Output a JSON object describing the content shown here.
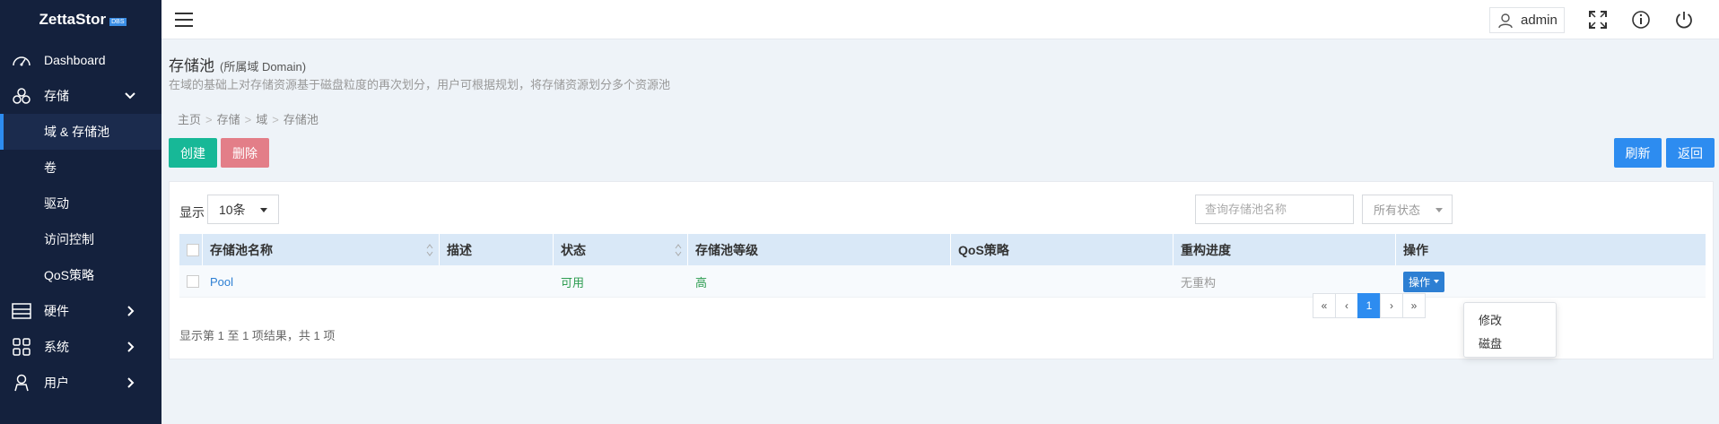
{
  "brand": {
    "name": "ZettaStor",
    "tag": "DBS"
  },
  "sidebar": {
    "items": [
      {
        "label": "Dashboard",
        "icon": "speedometer-icon"
      },
      {
        "label": "存储",
        "icon": "cubes-icon",
        "expanded": true
      },
      {
        "label": "硬件",
        "icon": "server-icon"
      },
      {
        "label": "系统",
        "icon": "grid-icon"
      },
      {
        "label": "用户",
        "icon": "user-icon"
      }
    ],
    "sub_items": [
      "域 & 存储池",
      "卷",
      "驱动",
      "访问控制",
      "QoS策略"
    ],
    "active_sub": "域 & 存储池"
  },
  "topbar": {
    "user": "admin",
    "icons": [
      "fullscreen-icon",
      "info-icon",
      "power-icon"
    ]
  },
  "page": {
    "title": "存储池",
    "subtitle": "(所属域 Domain)",
    "description": "在域的基础上对存储资源基于磁盘粒度的再次划分，用户可根据规划，将存储资源划分多个资源池",
    "breadcrumb": [
      "主页",
      "存储",
      "域",
      "存储池"
    ]
  },
  "actions": {
    "create": "创建",
    "delete": "删除",
    "refresh": "刷新",
    "back": "返回"
  },
  "table_controls": {
    "show_label": "显示",
    "page_size": "10条",
    "search_placeholder": "查询存储池名称",
    "status_filter": "所有状态"
  },
  "table": {
    "columns": [
      "存储池名称",
      "描述",
      "状态",
      "存储池等级",
      "QoS策略",
      "重构进度",
      "操作"
    ],
    "rows": [
      {
        "name": "Pool",
        "desc": "",
        "status": "可用",
        "level": "高",
        "qos": "",
        "rebuild": "无重构",
        "op": "操作"
      }
    ]
  },
  "summary": "显示第 1 至 1 项结果，共 1 项",
  "pagination": {
    "first": "«",
    "prev": "‹",
    "current": "1",
    "next": "›",
    "last": "»"
  },
  "dropdown": {
    "items": [
      "修改",
      "磁盘"
    ]
  },
  "colors": {
    "sidebar_bg": "#14213d",
    "accent": "#2d8cf0",
    "create": "#17b897",
    "delete": "#e37e88",
    "status_ok": "#2c9c50"
  }
}
